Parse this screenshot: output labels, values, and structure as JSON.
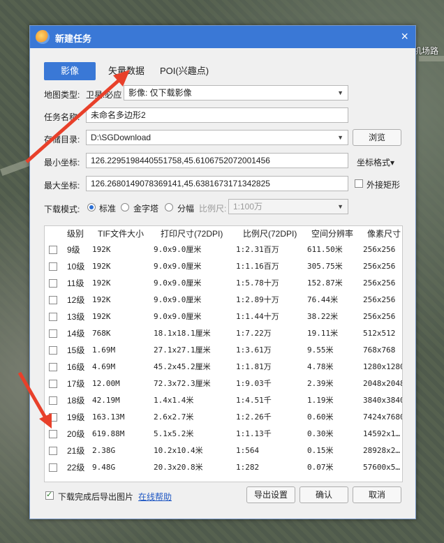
{
  "background": {
    "place_label": "机场路"
  },
  "dialog": {
    "title": "新建任务",
    "close": "×",
    "tabs": [
      "影像",
      "矢量数据",
      "POI(兴趣点)"
    ],
    "map_type": {
      "label": "地图类型:",
      "source": "卫星.必应",
      "value": "影像: 仅下载影像"
    },
    "task_name": {
      "label": "任务名称:",
      "value": "未命名多边形2"
    },
    "save_dir": {
      "label": "存储目录:",
      "value": "D:\\SGDownload",
      "browse": "浏览"
    },
    "min_coord": {
      "label": "最小坐标:",
      "value": "126.2295198440551758,45.6106752072001456",
      "format": "坐标格式"
    },
    "max_coord": {
      "label": "最大坐标:",
      "value": "126.2680149078369141,45.6381673171342825",
      "outer_rect": "外接矩形"
    },
    "mode": {
      "label": "下载模式:",
      "options": [
        "标准",
        "金字塔",
        "分幅"
      ],
      "scale_label": "比例尺:",
      "scale_value": "1:100万"
    },
    "table": {
      "headers": [
        "级别",
        "TIF文件大小",
        "打印尺寸(72DPI)",
        "比例尺(72DPI)",
        "空间分辨率",
        "像素尺寸"
      ],
      "rows": [
        {
          "level": "9级",
          "size": "192K",
          "print": "9.0x9.0厘米",
          "scale": "1:2.31百万",
          "res": "611.50米",
          "px": "256x256"
        },
        {
          "level": "10级",
          "size": "192K",
          "print": "9.0x9.0厘米",
          "scale": "1:1.16百万",
          "res": "305.75米",
          "px": "256x256"
        },
        {
          "level": "11级",
          "size": "192K",
          "print": "9.0x9.0厘米",
          "scale": "1:5.78十万",
          "res": "152.87米",
          "px": "256x256"
        },
        {
          "level": "12级",
          "size": "192K",
          "print": "9.0x9.0厘米",
          "scale": "1:2.89十万",
          "res": "76.44米",
          "px": "256x256"
        },
        {
          "level": "13级",
          "size": "192K",
          "print": "9.0x9.0厘米",
          "scale": "1:1.44十万",
          "res": "38.22米",
          "px": "256x256"
        },
        {
          "level": "14级",
          "size": "768K",
          "print": "18.1x18.1厘米",
          "scale": "1:7.22万",
          "res": "19.11米",
          "px": "512x512"
        },
        {
          "level": "15级",
          "size": "1.69M",
          "print": "27.1x27.1厘米",
          "scale": "1:3.61万",
          "res": "9.55米",
          "px": "768x768"
        },
        {
          "level": "16级",
          "size": "4.69M",
          "print": "45.2x45.2厘米",
          "scale": "1:1.81万",
          "res": "4.78米",
          "px": "1280x1280"
        },
        {
          "level": "17级",
          "size": "12.00M",
          "print": "72.3x72.3厘米",
          "scale": "1:9.03千",
          "res": "2.39米",
          "px": "2048x2048"
        },
        {
          "level": "18级",
          "size": "42.19M",
          "print": "1.4x1.4米",
          "scale": "1:4.51千",
          "res": "1.19米",
          "px": "3840x3840"
        },
        {
          "level": "19级",
          "size": "163.13M",
          "print": "2.6x2.7米",
          "scale": "1:2.26千",
          "res": "0.60米",
          "px": "7424x7680"
        },
        {
          "level": "20级",
          "size": "619.88M",
          "print": "5.1x5.2米",
          "scale": "1:1.13千",
          "res": "0.30米",
          "px": "14592x1…"
        },
        {
          "level": "21级",
          "size": "2.38G",
          "print": "10.2x10.4米",
          "scale": "1:564",
          "res": "0.15米",
          "px": "28928x2…"
        },
        {
          "level": "22级",
          "size": "9.48G",
          "print": "20.3x20.8米",
          "scale": "1:282",
          "res": "0.07米",
          "px": "57600x5…"
        }
      ]
    },
    "export_after": "下载完成后导出图片",
    "help": "在线帮助",
    "export_settings": "导出设置",
    "ok": "确认",
    "cancel": "取消"
  },
  "colors": {
    "accent": "#3a78d6",
    "annotation": "#e8402a"
  }
}
